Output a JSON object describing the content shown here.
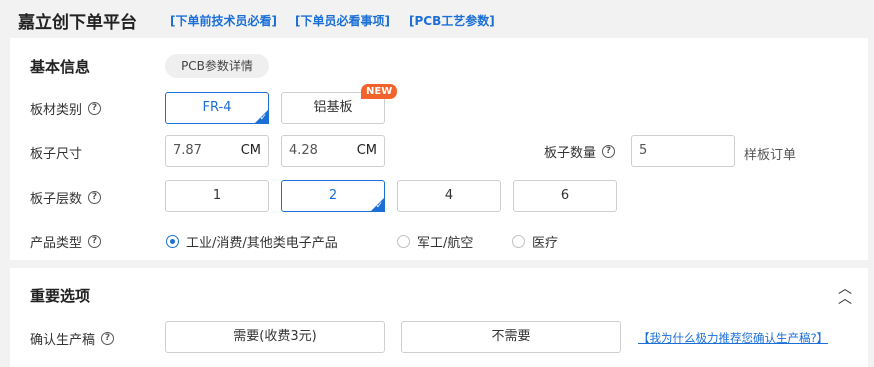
{
  "header": {
    "title": "嘉立创下单平台",
    "links": [
      "[下单前技术员必看]",
      "[下单员必看事项]",
      "[PCB工艺参数]"
    ]
  },
  "basic": {
    "title": "基本信息",
    "pill": "PCB参数详情",
    "material": {
      "label": "板材类别",
      "options": [
        "FR-4",
        "铝基板"
      ],
      "selected": "FR-4",
      "badge": "NEW"
    },
    "size": {
      "label": "板子尺寸",
      "width": "7.87",
      "height": "4.28",
      "unit": "CM"
    },
    "quantity": {
      "label": "板子数量",
      "value": "5",
      "suffix": "样板订单"
    },
    "layers": {
      "label": "板子层数",
      "options": [
        "1",
        "2",
        "4",
        "6"
      ],
      "selected": "2"
    },
    "product_type": {
      "label": "产品类型",
      "options": [
        "工业/消费/其他类电子产品",
        "军工/航空",
        "医疗"
      ],
      "selected": "工业/消费/其他类电子产品"
    }
  },
  "important": {
    "title": "重要选项",
    "confirm": {
      "label": "确认生产稿",
      "options": [
        "需要(收费3元)",
        "不需要"
      ],
      "link": "【我为什么极力推荐您确认生产稿?】"
    }
  },
  "colors": {
    "accent": "#1b6fd6",
    "badge": "#f2642b"
  }
}
